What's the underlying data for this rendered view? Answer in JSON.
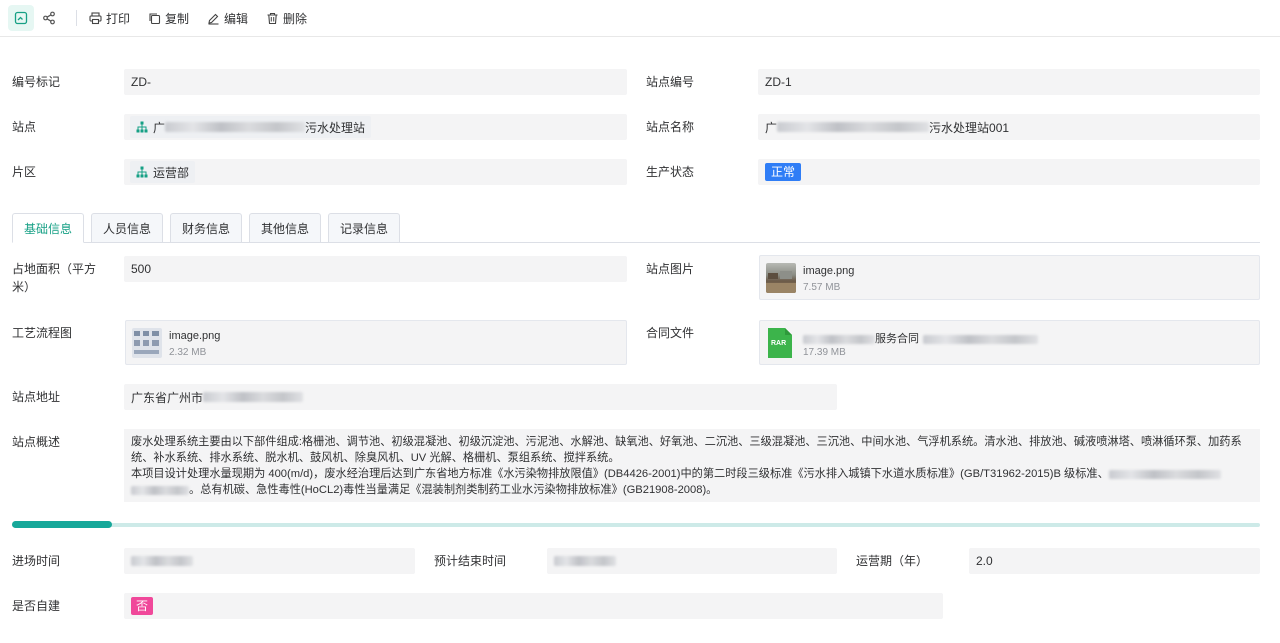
{
  "toolbar": {
    "print_label": "打印",
    "copy_label": "复制",
    "edit_label": "编辑",
    "delete_label": "删除"
  },
  "header_fields": {
    "code_mark_label": "编号标记",
    "code_mark_value": "ZD-",
    "station_code_label": "站点编号",
    "station_code_value": "ZD-1",
    "station_label": "站点",
    "station_prefix": "广",
    "station_suffix": "污水处理站",
    "station_name_label": "站点名称",
    "station_name_prefix": "广",
    "station_name_suffix": "污水处理站001",
    "area_label": "片区",
    "area_value": "运营部",
    "prod_status_label": "生产状态",
    "prod_status_value": "正常"
  },
  "tabs": [
    {
      "label": "基础信息",
      "active": true
    },
    {
      "label": "人员信息",
      "active": false
    },
    {
      "label": "财务信息",
      "active": false
    },
    {
      "label": "其他信息",
      "active": false
    },
    {
      "label": "记录信息",
      "active": false
    }
  ],
  "basic": {
    "land_area_label": "占地面积（平方米）",
    "land_area_value": "500",
    "station_image_label": "站点图片",
    "station_image_name": "image.png",
    "station_image_size": "7.57 MB",
    "process_flow_label": "工艺流程图",
    "process_flow_name": "image.png",
    "process_flow_size": "2.32 MB",
    "contract_label": "合同文件",
    "contract_badge": "RAR",
    "contract_name_mid": "服务合同",
    "contract_size": "17.39 MB",
    "address_label": "站点地址",
    "address_value": "广东省广州市",
    "overview_label": "站点概述",
    "overview_line1": "废水处理系统主要由以下部件组成:格栅池、调节池、初级混凝池、初级沉淀池、污泥池、水解池、缺氧池、好氧池、二沉池、三级混凝池、三沉池、中间水池、气浮机系统。清水池、排放池、碱液喷淋塔、喷淋循环泵、加药系",
    "overview_line2": "统、补水系统、排水系统、脱水机、鼓风机、除臭风机、UV 光解、格栅机、泵组系统、搅拌系统。",
    "overview_line3": "本项目设计处理水量现期为 400(m/d)，废水经治理后达到广东省地方标准《水污染物排放限值》(DB4426-2001)中的第二时段三级标准《污水排入城镇下水道水质标准》(GB/T31962-2015)B 级标准、",
    "overview_line4": "。总有机碳、急性毒性(HoCL2)毒性当量满足《混装制剂类制药工业水污染物排放标准》(GB21908-2008)。",
    "progress": 0.08
  },
  "timing": {
    "entry_time_label": "进场时间",
    "planned_end_label": "预计结束时间",
    "operation_period_label": "运营期（年）",
    "operation_period_value": "2.0",
    "self_built_label": "是否自建",
    "self_built_value": "否"
  },
  "colors": {
    "accent": "#16a085",
    "status_normal": "#2f7df6",
    "tag_no": "#f0489a",
    "rar_green": "#3cb44b"
  }
}
